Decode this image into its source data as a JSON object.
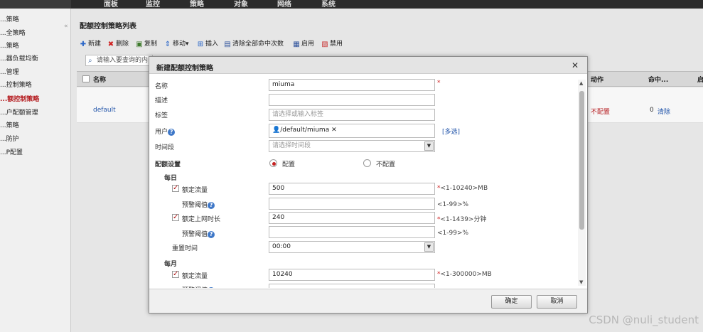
{
  "topnav": [
    "面板",
    "监控",
    "策略",
    "对象",
    "网络",
    "系统"
  ],
  "sidebar": {
    "items": [
      "...策略",
      "...全策略",
      "...策略",
      "...器负载均衡",
      "...管理",
      "...控制策略",
      "...额控制策略",
      "...户配额管理",
      "...策略",
      "...防护",
      "...P配置"
    ],
    "active_index": 6
  },
  "page": {
    "title": "配额控制策略列表",
    "toolbar": [
      "新建",
      "删除",
      "复制",
      "移动",
      "插入",
      "清除全部命中次数",
      "启用",
      "禁用"
    ],
    "search_placeholder": "请输入要查询的内",
    "columns": [
      "名称",
      "动作",
      "命中...",
      "启"
    ],
    "rows": [
      {
        "name": "default",
        "action": "不配置",
        "hits": "0",
        "clear": "清除"
      }
    ]
  },
  "modal": {
    "title": "新建配额控制策略",
    "labels": {
      "name": "名称",
      "desc": "描述",
      "tag": "标签",
      "user": "用户",
      "time": "时间段",
      "quota_settings": "配额设置",
      "daily": "每日",
      "flow_limit": "额定流量",
      "alert": "预警阈值",
      "online_limit": "额定上网时长",
      "reset": "重置时间",
      "monthly": "每月"
    },
    "values": {
      "name": "miuma",
      "tag_placeholder": "请选择或输入标签",
      "user_tag": "/default/miuma",
      "time_placeholder": "请选择时间段",
      "daily_flow": "500",
      "daily_time": "240",
      "reset_time": "00:00",
      "monthly_flow": "10240"
    },
    "hints": {
      "daily_flow": "<1-10240>MB",
      "percent": "<1-99>%",
      "daily_time": "<1-1439>分钟",
      "monthly_flow": "<1-300000>MB"
    },
    "multi_select": "[多选]",
    "radio_on": "配置",
    "radio_off": "不配置",
    "ok": "确定",
    "cancel": "取消"
  },
  "watermark": "CSDN @nuli_student",
  "colors": {
    "accent_red": "#b4191d",
    "link_blue": "#2255aa",
    "help_blue": "#3f78c8"
  }
}
